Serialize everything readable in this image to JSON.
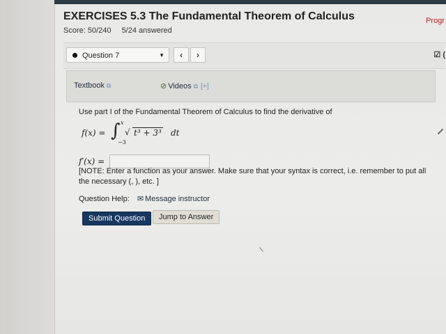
{
  "header": {
    "title": "EXERCISES 5.3 The Fundamental Theorem of Calculus",
    "score": "Score: 50/240",
    "answered": "5/24 answered",
    "progress_link": "Progr"
  },
  "nav": {
    "question_select": "Question 7",
    "prev_icon": "‹",
    "next_icon": "›",
    "right_icon": "☑ (",
    "icons": [
      "dropdown-caret-icon",
      "chevron-left-icon",
      "chevron-right-icon",
      "checkbox-icon"
    ]
  },
  "resources": {
    "textbook": "Textbook",
    "videos": "Videos",
    "expand": "[+]"
  },
  "question": {
    "prompt": "Use part I of the Fundamental Theorem of Calculus to find the derivative of",
    "formula": {
      "lhs": "f(x) =",
      "integral_sign": "∫",
      "upper_limit": "x",
      "lower_limit": "−3",
      "root_sign": "√",
      "radicand": "t³ + 3³",
      "differential": "dt"
    },
    "answer_label": "f′(x) =",
    "answer_value": "",
    "note": "[NOTE: Enter a function as your answer. Make sure that your syntax is correct, i.e. remember to put all the necessary (, ), etc. ]",
    "help_label": "Question Help:",
    "message_instructor": "Message instructor"
  },
  "actions": {
    "submit": "Submit Question",
    "jump": "Jump to Answer"
  },
  "colors": {
    "top_bar": "#2c3a46",
    "submit_bg": "#17375f",
    "progress_link": "#b22222"
  }
}
